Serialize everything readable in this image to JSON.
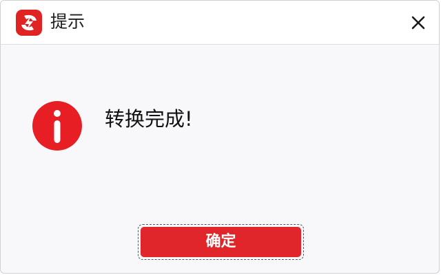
{
  "window": {
    "title": "提示",
    "app_icon": "app-logo-icon",
    "close_icon": "close-icon"
  },
  "message": {
    "icon": "info-icon",
    "text": "转换完成!"
  },
  "actions": {
    "ok_label": "确定"
  },
  "colors": {
    "accent": "#e0262a",
    "background": "#f8f7fa",
    "titlebar": "#ffffff",
    "text": "#111111"
  }
}
